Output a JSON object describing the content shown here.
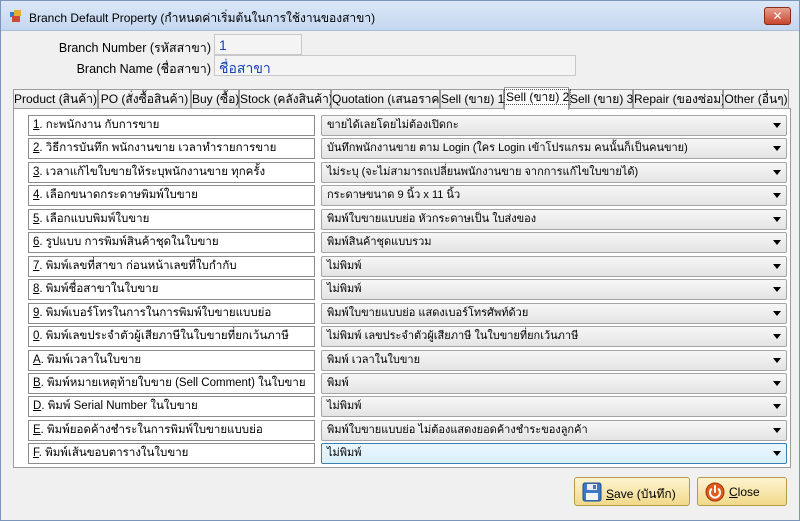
{
  "window": {
    "title": "Branch Default Property (กำหนดค่าเริ่มต้นในการใช้งานของสาขา)",
    "close_glyph": "✕"
  },
  "header": {
    "branch_number_label": "Branch Number (รหัสสาขา)",
    "branch_number_value": "1",
    "branch_name_label": "Branch Name (ชื่อสาขา)",
    "branch_name_value": "ชื่อสาขา"
  },
  "tabs": [
    {
      "label": "Product (สินค้า)"
    },
    {
      "label": "PO (สั่งซื้อสินค้า)"
    },
    {
      "label": "Buy (ซื้อ)"
    },
    {
      "label": "Stock (คลังสินค้า)"
    },
    {
      "label": "Quotation (เสนอราคา)"
    },
    {
      "label": "Sell (ขาย) 1"
    },
    {
      "label": "Sell (ขาย) 2",
      "active": true
    },
    {
      "label": "Sell (ขาย) 3"
    },
    {
      "label": "Repair (ของซ่อม)"
    },
    {
      "label": "Other (อื่นๆ)"
    }
  ],
  "rows": [
    {
      "key": "1",
      "label": ". กะพนักงาน กับการขาย",
      "value": "ขายได้เลยโดยไม่ต้องเปิดกะ"
    },
    {
      "key": "2",
      "label": ". วิธีการบันทึก พนักงานขาย เวลาทำรายการขาย",
      "value": "บันทึกพนักงานขาย ตาม Login (ใคร Login เข้าโปรแกรม คนนั้นก็เป็นคนขาย)"
    },
    {
      "key": "3",
      "label": ". เวลาแก้ไขใบขายให้ระบุพนักงานขาย ทุกครั้ง",
      "value": "ไม่ระบุ (จะไม่สามารถเปลี่ยนพนักงานขาย จากการแก้ไขใบขายได้)"
    },
    {
      "key": "4",
      "label": ". เลือกขนาดกระดาษพิมพ์ใบขาย",
      "value": "กระดาษขนาด 9 นิ้ว x 11 นิ้ว"
    },
    {
      "key": "5",
      "label": ". เลือกแบบพิมพ์ใบขาย",
      "value": "พิมพ์ใบขายแบบย่อ หัวกระดาษเป็น ใบส่งของ"
    },
    {
      "key": "6",
      "label": ". รูปแบบ การพิมพ์สินค้าชุดในใบขาย",
      "value": "พิมพ์สินค้าชุดแบบรวม"
    },
    {
      "key": "7",
      "label": ". พิมพ์เลขที่สาขา ก่อนหน้าเลขที่ใบกำกับ",
      "value": "ไม่พิมพ์"
    },
    {
      "key": "8",
      "label": ". พิมพ์ชื่อสาขาในใบขาย",
      "value": "ไม่พิมพ์"
    },
    {
      "key": "9",
      "label": ". พิมพ์เบอร์โทรในการในการพิมพ์ใบขายแบบย่อ",
      "value": "พิมพ์ใบขายแบบย่อ แสดงเบอร์โทรศัพท์ด้วย"
    },
    {
      "key": "0",
      "label": ". พิมพ์เลขประจำตัวผู้เสียภาษีในใบขายที่ยกเว้นภาษี",
      "value": "ไม่พิมพ์ เลขประจำตัวผู้เสียภาษี ในใบขายที่ยกเว้นภาษี"
    },
    {
      "key": "A",
      "label": ". พิมพ์เวลาในใบขาย",
      "value": "พิมพ์ เวลาในใบขาย"
    },
    {
      "key": "B",
      "label": ". พิมพ์หมายเหตุท้ายใบขาย (Sell Comment) ในใบขาย",
      "value": "พิมพ์"
    },
    {
      "key": "D",
      "label": ". พิมพ์ Serial Number ในใบขาย",
      "value": "ไม่พิมพ์"
    },
    {
      "key": "E",
      "label": ". พิมพ์ยอดค้างชำระในการพิมพ์ใบขายแบบย่อ",
      "value": "พิมพ์ใบขายแบบย่อ ไม่ต้องแสดงยอดค้างชำระของลูกค้า"
    },
    {
      "key": "F",
      "label": ". พิมพ์เส้นขอบตารางในใบขาย",
      "value": "ไม่พิมพ์",
      "focused": true
    }
  ],
  "buttons": {
    "save_key": "S",
    "save_rest": "ave (บันทึก)",
    "close_key": "C",
    "close_rest": "lose"
  },
  "colors": {
    "branch_value_text": "#1a3fb5",
    "button_bg": "#f1d98a"
  }
}
